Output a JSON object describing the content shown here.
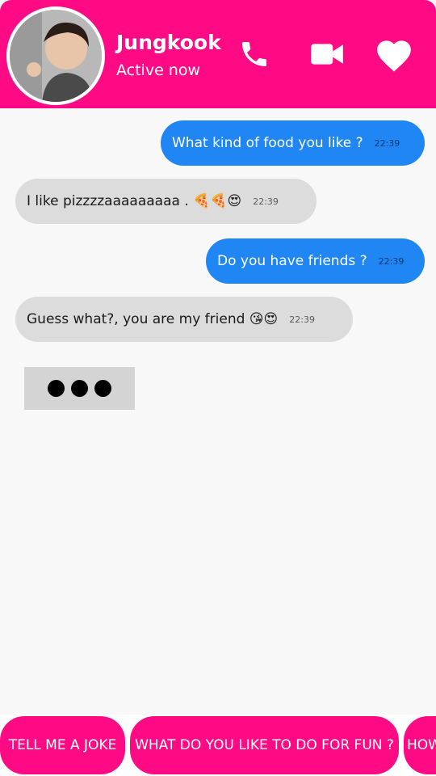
{
  "header": {
    "contact_name": "Jungkook",
    "status": "Active now",
    "accent_color": "#ff0a85",
    "icons": [
      "phone-icon",
      "video-camera-icon",
      "heart-icon"
    ]
  },
  "messages": [
    {
      "direction": "outgoing",
      "text": "What kind of food you like ?",
      "time": "22:39"
    },
    {
      "direction": "incoming",
      "text": "I like pizzzzaaaaaaaaa . 🍕🍕😍",
      "time": "22:39"
    },
    {
      "direction": "outgoing",
      "text": "Do you have friends ?",
      "time": "22:39"
    },
    {
      "direction": "incoming",
      "text": "Guess what?, you are my friend 😘😍",
      "time": "22:39"
    }
  ],
  "typing_indicator": "●●●",
  "suggestions": [
    "TELL ME A JOKE",
    "WHAT DO YOU LIKE TO DO FOR FUN ?",
    "HOW"
  ],
  "colors": {
    "outgoing_bubble": "#1f86f4",
    "incoming_bubble": "#dcdcdc",
    "chip": "#ff0a85"
  }
}
